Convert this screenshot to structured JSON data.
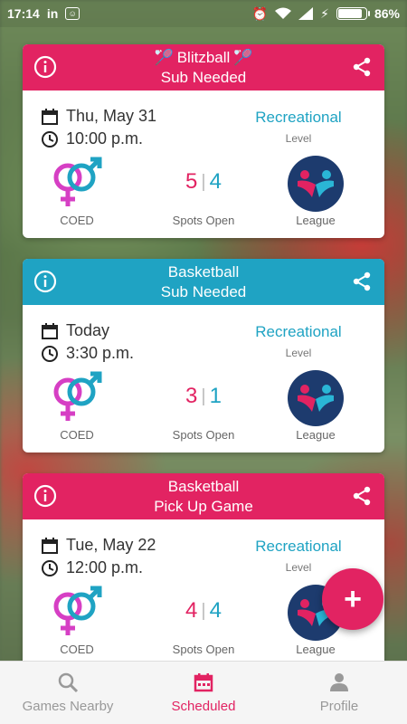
{
  "status_bar": {
    "time": "17:14",
    "linkedin": "in",
    "battery_pct": "86%",
    "battery_level": 0.86
  },
  "colors": {
    "pink": "#e22362",
    "blue": "#1fa3c3",
    "navy": "#1d3b6e"
  },
  "cards": [
    {
      "header_color": "#e22362",
      "sport": "Blitzball",
      "show_rackets": true,
      "kind": "Sub Needed",
      "date": "Thu, May 31",
      "time": "10:00 p.m.",
      "level": "Recreational",
      "level_label": "Level",
      "gender": "COED",
      "spots_a": "5",
      "spots_b": "4",
      "spots_label": "Spots Open",
      "league_label": "League"
    },
    {
      "header_color": "#1fa3c3",
      "sport": "Basketball",
      "show_rackets": false,
      "kind": "Sub Needed",
      "date": "Today",
      "time": "3:30 p.m.",
      "level": "Recreational",
      "level_label": "Level",
      "gender": "COED",
      "spots_a": "3",
      "spots_b": "1",
      "spots_label": "Spots Open",
      "league_label": "League"
    },
    {
      "header_color": "#e22362",
      "sport": "Basketball",
      "show_rackets": false,
      "kind": "Pick Up Game",
      "date": "Tue, May 22",
      "time": "12:00 p.m.",
      "level": "Recreational",
      "level_label": "Level",
      "gender": "COED",
      "spots_a": "4",
      "spots_b": "4",
      "spots_label": "Spots Open",
      "league_label": "League"
    }
  ],
  "fab": {
    "label": "+"
  },
  "bottom_nav": [
    {
      "label": "Games Nearby",
      "icon": "search-icon",
      "active": false
    },
    {
      "label": "Scheduled",
      "icon": "calendar-icon",
      "active": true
    },
    {
      "label": "Profile",
      "icon": "person-icon",
      "active": false
    }
  ]
}
